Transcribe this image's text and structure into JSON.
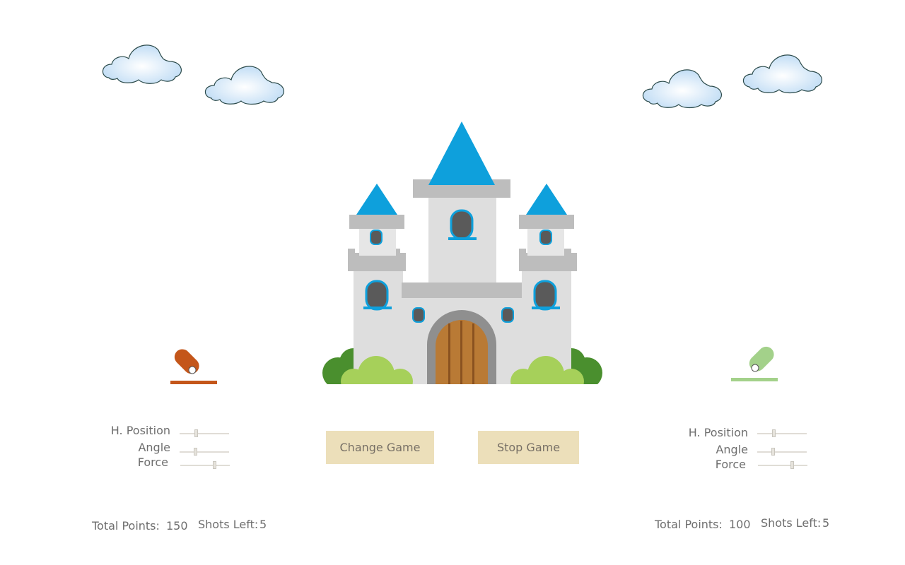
{
  "player1": {
    "color": "#c4561a",
    "controls": {
      "h_position_label": "H. Position",
      "angle_label": "Angle",
      "force_label": "Force",
      "h_position_value": 0.33,
      "angle_value": 0.3,
      "force_value": 0.7
    },
    "total_points_label": "Total Points:",
    "total_points": "150",
    "shots_left_label": "Shots Left:",
    "shots_left": "5"
  },
  "player2": {
    "color": "#a3d18a",
    "controls": {
      "h_position_label": "H. Position",
      "angle_label": "Angle",
      "force_label": "Force",
      "h_position_value": 0.33,
      "angle_value": 0.3,
      "force_value": 0.7
    },
    "total_points_label": "Total Points:",
    "total_points": "100",
    "shots_left_label": "Shots Left:",
    "shots_left": "5"
  },
  "buttons": {
    "change_game": "Change Game",
    "stop_game": "Stop Game"
  },
  "colors": {
    "button_bg": "#ecdfba",
    "tower_roof": "#0ea0dc",
    "castle_wall": "#dcdcdc",
    "door": "#b97a35",
    "bush": "#a6d05a",
    "bush_dark": "#4a8f2e"
  }
}
